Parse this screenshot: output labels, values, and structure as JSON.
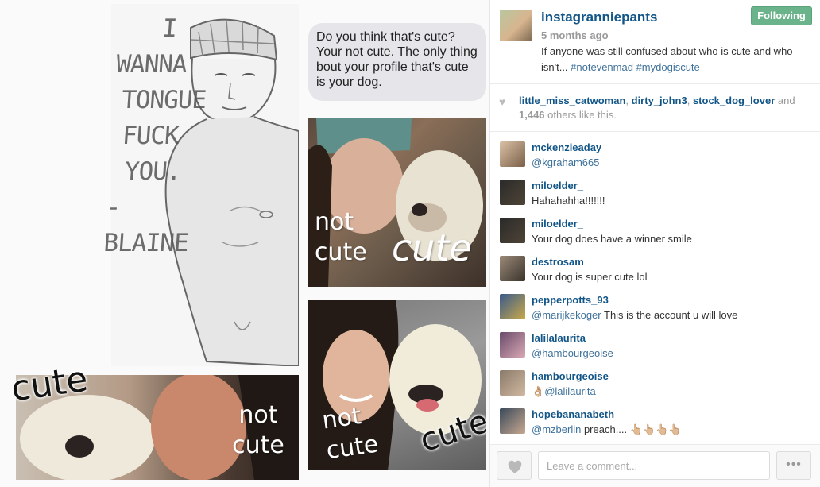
{
  "post": {
    "author": "instagranniepants",
    "follow_label": "Following",
    "time_ago": "5 months ago",
    "caption_text": "If anyone was still confused about who is cute and who isn't... ",
    "caption_tags": "#notevenmad #mydogiscute"
  },
  "media": {
    "sketch_lines": [
      "I",
      "WANNA",
      "TONGUE",
      "FUCK",
      "YOU.",
      "-BLAINE"
    ],
    "bubble_text": "Do you think that's cute? Your not cute. The only thing bout your profile that's cute is your dog.",
    "panels": [
      {
        "not_label": "not cute",
        "cute_label": "cute"
      },
      {
        "not_label": "not cute",
        "cute_label": "cute"
      },
      {
        "not_label": "not cute",
        "cute_label": "cute"
      }
    ]
  },
  "likes": {
    "users": [
      "little_miss_catwoman",
      "dirty_john3",
      "stock_dog_lover"
    ],
    "and_word": "and",
    "count": "1,446",
    "tail": "others like this."
  },
  "comments": [
    {
      "user": "mckenzieaday",
      "mention": "@kgraham665",
      "text": ""
    },
    {
      "user": "miloelder_",
      "mention": "",
      "text": "Hahahahha!!!!!!!"
    },
    {
      "user": "miloelder_",
      "mention": "",
      "text": "Your dog does have a winner smile"
    },
    {
      "user": "destrosam",
      "mention": "",
      "text": "Your dog is super cute lol"
    },
    {
      "user": "pepperpotts_93",
      "mention": "@marijkekoger",
      "text": " This is the account u will love"
    },
    {
      "user": "lalilalaurita",
      "mention": "@hambourgeoise",
      "text": ""
    },
    {
      "user": "hambourgeoise",
      "mention": "@lalilaurita",
      "text": "👌🏼"
    },
    {
      "user": "hopebananabeth",
      "mention": "@mzberlin",
      "text": " preach.... 👆🏼👆🏼👆🏼👆🏼"
    }
  ],
  "footer": {
    "comment_placeholder": "Leave a comment...",
    "more_label": "•••"
  },
  "colors": {
    "link": "#125688",
    "tag": "#3f729b",
    "follow_button": "#6bb38a"
  }
}
